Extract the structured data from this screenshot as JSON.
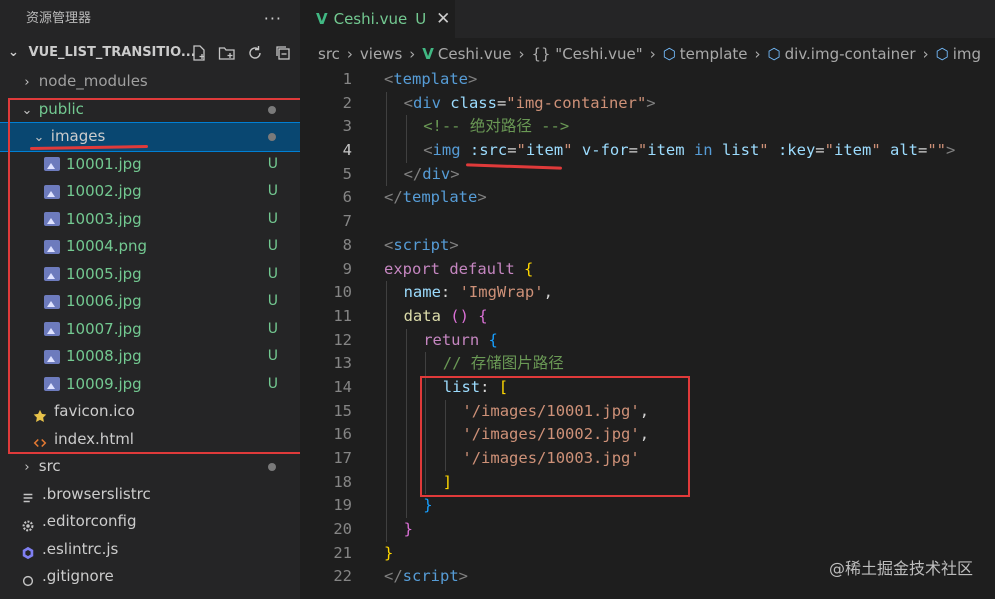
{
  "sidebar": {
    "title": "资源管理器",
    "more": "···",
    "project": "VUE_LIST_TRANSITIO...",
    "tree": [
      {
        "label": "node_modules",
        "type": "folder",
        "open": false,
        "indent": 0,
        "color": "grey",
        "decoration": ""
      },
      {
        "label": "public",
        "type": "folder",
        "open": true,
        "indent": 0,
        "color": "green",
        "decoration": "dot"
      },
      {
        "label": "images",
        "type": "folder",
        "open": true,
        "indent": 1,
        "color": "white",
        "decoration": "dot",
        "selected": true
      },
      {
        "label": "10001.jpg",
        "type": "image",
        "indent": 2,
        "color": "green",
        "decoration": "U"
      },
      {
        "label": "10002.jpg",
        "type": "image",
        "indent": 2,
        "color": "green",
        "decoration": "U"
      },
      {
        "label": "10003.jpg",
        "type": "image",
        "indent": 2,
        "color": "green",
        "decoration": "U"
      },
      {
        "label": "10004.png",
        "type": "image",
        "indent": 2,
        "color": "green",
        "decoration": "U"
      },
      {
        "label": "10005.jpg",
        "type": "image",
        "indent": 2,
        "color": "green",
        "decoration": "U"
      },
      {
        "label": "10006.jpg",
        "type": "image",
        "indent": 2,
        "color": "green",
        "decoration": "U"
      },
      {
        "label": "10007.jpg",
        "type": "image",
        "indent": 2,
        "color": "green",
        "decoration": "U"
      },
      {
        "label": "10008.jpg",
        "type": "image",
        "indent": 2,
        "color": "green",
        "decoration": "U"
      },
      {
        "label": "10009.jpg",
        "type": "image",
        "indent": 2,
        "color": "green",
        "decoration": "U"
      },
      {
        "label": "favicon.ico",
        "type": "star",
        "indent": 1,
        "color": "white",
        "decoration": ""
      },
      {
        "label": "index.html",
        "type": "html",
        "indent": 1,
        "color": "white",
        "decoration": ""
      },
      {
        "label": "src",
        "type": "folder",
        "open": false,
        "indent": 0,
        "color": "white",
        "decoration": "dot"
      },
      {
        "label": ".browserslistrc",
        "type": "lines",
        "indent": 0,
        "color": "white",
        "decoration": ""
      },
      {
        "label": ".editorconfig",
        "type": "gear",
        "indent": 0,
        "color": "white",
        "decoration": ""
      },
      {
        "label": ".eslintrc.js",
        "type": "eslint",
        "indent": 0,
        "color": "white",
        "decoration": ""
      },
      {
        "label": ".gitignore",
        "type": "git",
        "indent": 0,
        "color": "white",
        "decoration": ""
      }
    ]
  },
  "editor": {
    "tab": {
      "name": "Ceshi.vue",
      "status": "U",
      "close": "✕"
    },
    "breadcrumb": [
      "src",
      "views",
      "Ceshi.vue",
      "{} \"Ceshi.vue\"",
      "template",
      "div.img-container",
      "img"
    ],
    "current_line": 4,
    "lines": [
      {
        "n": "1",
        "indent": 0,
        "tokens": [
          [
            "t-punc",
            "<"
          ],
          [
            "t-tag",
            "template"
          ],
          [
            "t-punc",
            ">"
          ]
        ]
      },
      {
        "n": "2",
        "indent": 1,
        "tokens": [
          [
            "t-punc",
            "<"
          ],
          [
            "t-tag",
            "div"
          ],
          [
            "t-plain",
            " "
          ],
          [
            "t-attr",
            "class"
          ],
          [
            "t-plain",
            "="
          ],
          [
            "t-str",
            "\"img-container\""
          ],
          [
            "t-punc",
            ">"
          ]
        ]
      },
      {
        "n": "3",
        "indent": 2,
        "tokens": [
          [
            "t-com",
            "<!-- 绝对路径 -->"
          ]
        ]
      },
      {
        "n": "4",
        "indent": 2,
        "tokens": [
          [
            "t-punc",
            "<"
          ],
          [
            "t-tag",
            "img"
          ],
          [
            "t-plain",
            " "
          ],
          [
            "t-attr",
            ":src"
          ],
          [
            "t-plain",
            "="
          ],
          [
            "t-str",
            "\""
          ],
          [
            "t-attr",
            "item"
          ],
          [
            "t-str",
            "\""
          ],
          [
            "t-plain",
            " "
          ],
          [
            "t-attr",
            "v-for"
          ],
          [
            "t-plain",
            "="
          ],
          [
            "t-str",
            "\""
          ],
          [
            "t-attr",
            "item"
          ],
          [
            "t-plain",
            " "
          ],
          [
            "t-key",
            "in"
          ],
          [
            "t-plain",
            " "
          ],
          [
            "t-attr",
            "list"
          ],
          [
            "t-str",
            "\""
          ],
          [
            "t-plain",
            " "
          ],
          [
            "t-attr",
            ":key"
          ],
          [
            "t-plain",
            "="
          ],
          [
            "t-str",
            "\""
          ],
          [
            "t-attr",
            "item"
          ],
          [
            "t-str",
            "\""
          ],
          [
            "t-plain",
            " "
          ],
          [
            "t-attr",
            "alt"
          ],
          [
            "t-plain",
            "="
          ],
          [
            "t-str",
            "\"\""
          ],
          [
            "t-punc",
            ">"
          ]
        ]
      },
      {
        "n": "5",
        "indent": 1,
        "tokens": [
          [
            "t-punc",
            "</"
          ],
          [
            "t-tag",
            "div"
          ],
          [
            "t-punc",
            ">"
          ]
        ]
      },
      {
        "n": "6",
        "indent": 0,
        "tokens": [
          [
            "t-punc",
            "</"
          ],
          [
            "t-tag",
            "template"
          ],
          [
            "t-punc",
            ">"
          ]
        ]
      },
      {
        "n": "7",
        "indent": 0,
        "tokens": []
      },
      {
        "n": "8",
        "indent": 0,
        "tokens": [
          [
            "t-punc",
            "<"
          ],
          [
            "t-tag",
            "script"
          ],
          [
            "t-punc",
            ">"
          ]
        ]
      },
      {
        "n": "9",
        "indent": 0,
        "tokens": [
          [
            "t-kw2",
            "export"
          ],
          [
            "t-plain",
            " "
          ],
          [
            "t-kw2",
            "default"
          ],
          [
            "t-plain",
            " "
          ],
          [
            "t-br",
            "{"
          ]
        ]
      },
      {
        "n": "10",
        "indent": 1,
        "tokens": [
          [
            "t-attr",
            "name"
          ],
          [
            "t-plain",
            ": "
          ],
          [
            "t-str",
            "'ImgWrap'"
          ],
          [
            "t-plain",
            ","
          ]
        ]
      },
      {
        "n": "11",
        "indent": 1,
        "tokens": [
          [
            "t-fn",
            "data"
          ],
          [
            "t-plain",
            " "
          ],
          [
            "t-br2",
            "()"
          ],
          [
            "t-plain",
            " "
          ],
          [
            "t-br2",
            "{"
          ]
        ]
      },
      {
        "n": "12",
        "indent": 2,
        "tokens": [
          [
            "t-kw2",
            "return"
          ],
          [
            "t-plain",
            " "
          ],
          [
            "t-br3",
            "{"
          ]
        ]
      },
      {
        "n": "13",
        "indent": 3,
        "tokens": [
          [
            "t-com",
            "// 存储图片路径"
          ]
        ]
      },
      {
        "n": "14",
        "indent": 3,
        "tokens": [
          [
            "t-attr",
            "list"
          ],
          [
            "t-plain",
            ": "
          ],
          [
            "t-br",
            "["
          ]
        ]
      },
      {
        "n": "15",
        "indent": 4,
        "tokens": [
          [
            "t-str",
            "'/images/10001.jpg'"
          ],
          [
            "t-plain",
            ","
          ]
        ]
      },
      {
        "n": "16",
        "indent": 4,
        "tokens": [
          [
            "t-str",
            "'/images/10002.jpg'"
          ],
          [
            "t-plain",
            ","
          ]
        ]
      },
      {
        "n": "17",
        "indent": 4,
        "tokens": [
          [
            "t-str",
            "'/images/10003.jpg'"
          ]
        ]
      },
      {
        "n": "18",
        "indent": 3,
        "tokens": [
          [
            "t-br",
            "]"
          ]
        ]
      },
      {
        "n": "19",
        "indent": 2,
        "tokens": [
          [
            "t-br3",
            "}"
          ]
        ]
      },
      {
        "n": "20",
        "indent": 1,
        "tokens": [
          [
            "t-br2",
            "}"
          ]
        ]
      },
      {
        "n": "21",
        "indent": 0,
        "tokens": [
          [
            "t-br",
            "}"
          ]
        ]
      },
      {
        "n": "22",
        "indent": 0,
        "tokens": [
          [
            "t-punc",
            "</"
          ],
          [
            "t-tag",
            "script"
          ],
          [
            "t-punc",
            ">"
          ]
        ]
      }
    ]
  },
  "watermark": "@稀土掘金技术社区"
}
